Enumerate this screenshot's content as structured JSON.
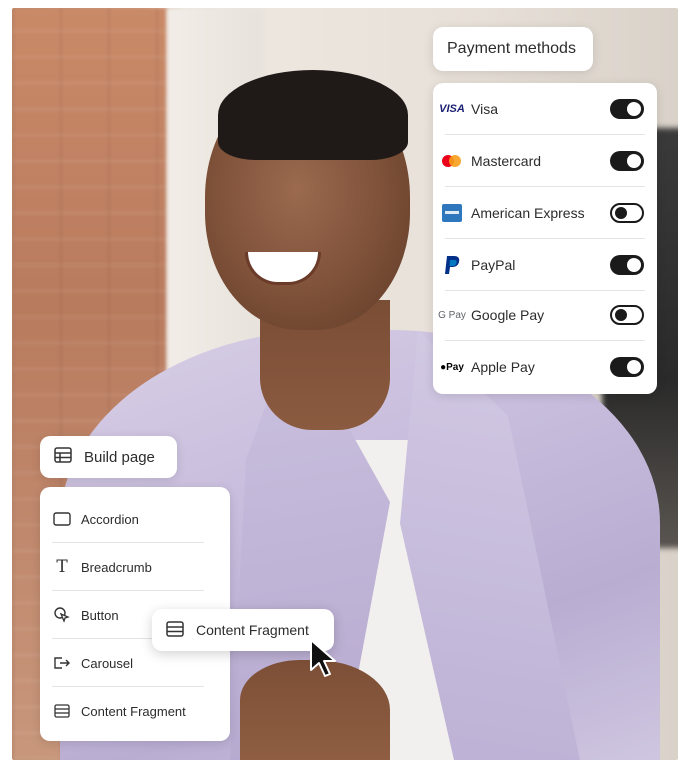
{
  "payment": {
    "title": "Payment methods",
    "methods": [
      {
        "label": "Visa",
        "logo": "visa-logo",
        "enabled": true,
        "logo_text": "VISA"
      },
      {
        "label": "Mastercard",
        "logo": "mastercard-logo",
        "enabled": true
      },
      {
        "label": "American Express",
        "logo": "amex-logo",
        "enabled": false
      },
      {
        "label": "PayPal",
        "logo": "paypal-logo",
        "enabled": true
      },
      {
        "label": "Google Pay",
        "logo": "google-pay-logo",
        "enabled": false,
        "logo_text": "G Pay"
      },
      {
        "label": "Apple Pay",
        "logo": "apple-pay-logo",
        "enabled": true,
        "logo_text": "Pay"
      }
    ]
  },
  "builder": {
    "title": "Build page",
    "components": [
      {
        "label": "Accordion",
        "icon": "accordion-icon"
      },
      {
        "label": "Breadcrumb",
        "icon": "breadcrumb-icon"
      },
      {
        "label": "Button",
        "icon": "button-icon"
      },
      {
        "label": "Carousel",
        "icon": "carousel-icon"
      },
      {
        "label": "Content Fragment",
        "icon": "content-fragment-icon"
      }
    ],
    "dragging": {
      "label": "Content Fragment",
      "icon": "content-fragment-icon"
    }
  },
  "colors": {
    "toggle_on": "#1a1a1a",
    "mastercard_red": "#eb001b",
    "mastercard_orange": "#f79e1b",
    "amex_blue": "#2e77bc",
    "paypal_blue": "#003087",
    "visa_blue": "#1a1f71"
  }
}
